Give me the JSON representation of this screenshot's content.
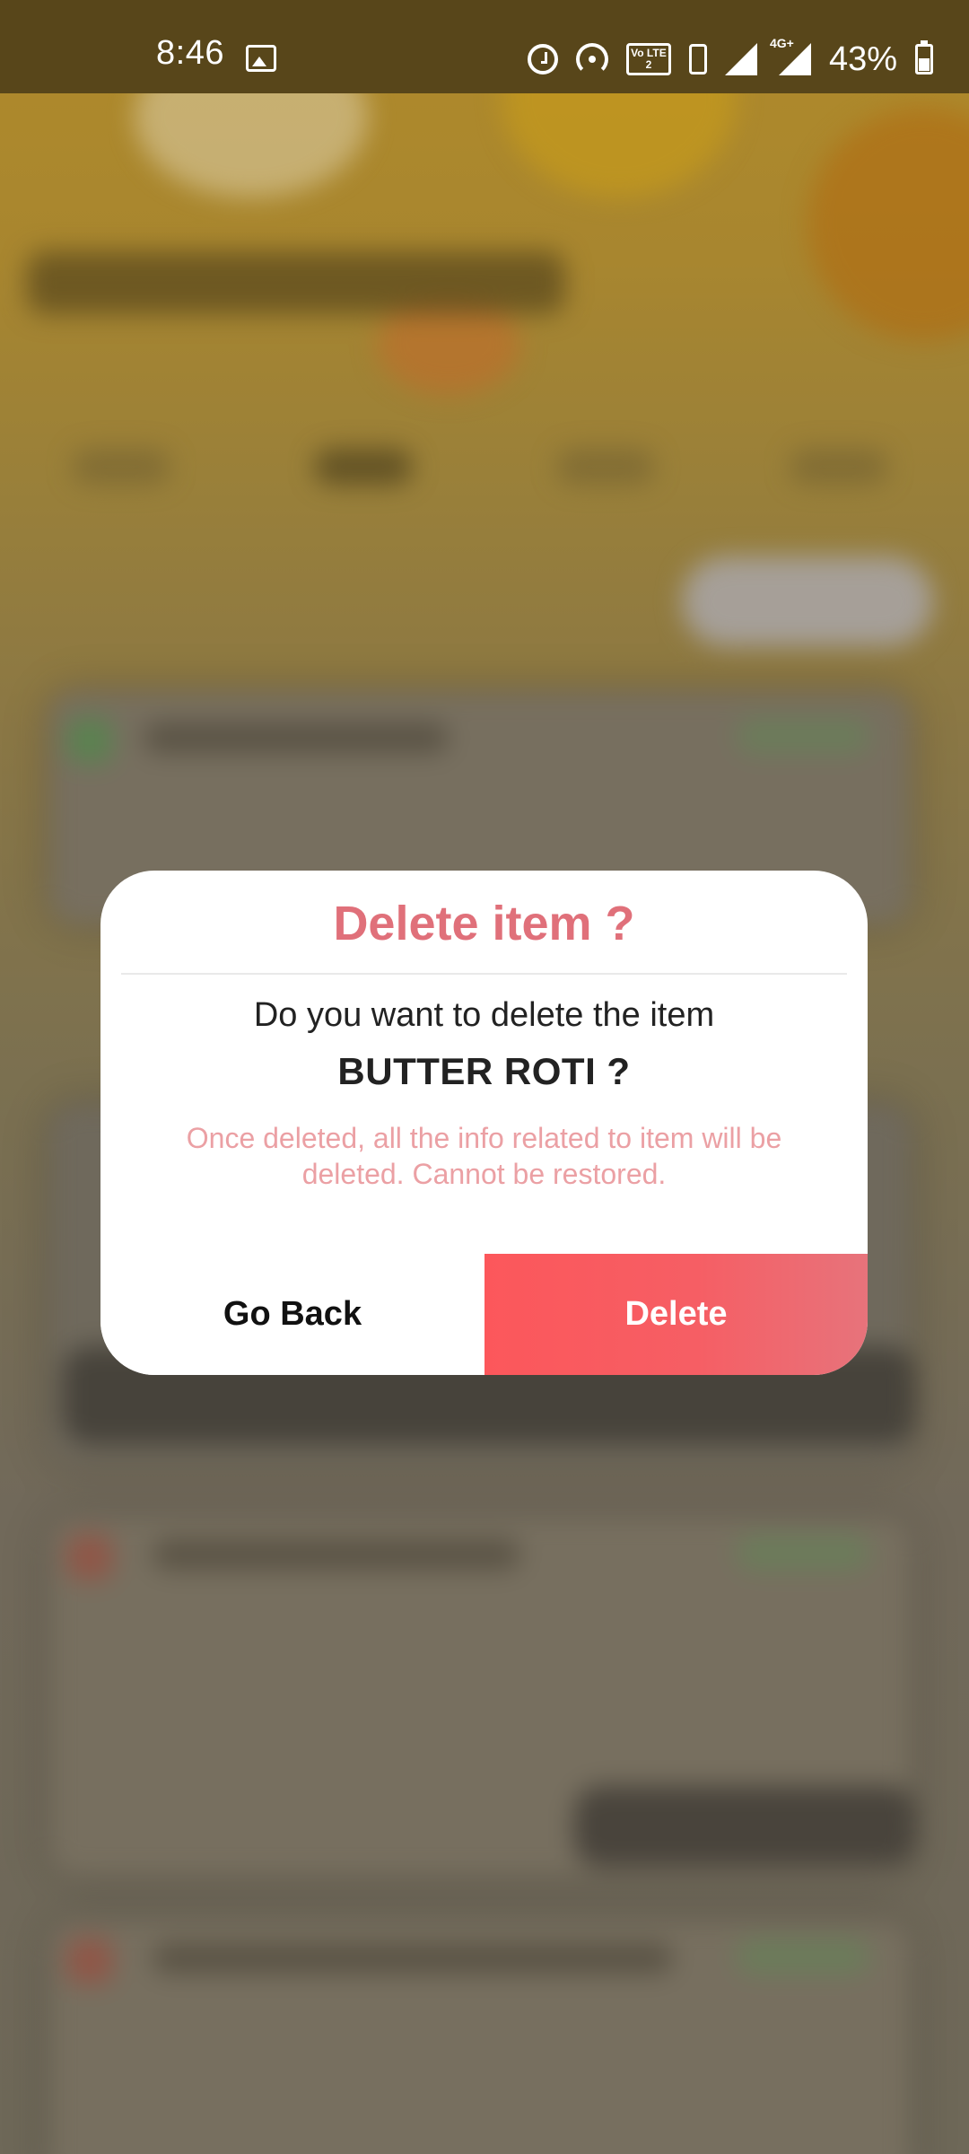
{
  "status_bar": {
    "time": "8:46",
    "battery_percent": "43%",
    "network_label": "4G+",
    "volte_label": "Vo LTE 2",
    "icons": [
      "gallery-icon",
      "alarm-icon",
      "hotspot-icon",
      "volte-icon",
      "vibrate-icon",
      "signal-icon",
      "signal-4g-icon",
      "battery-icon"
    ]
  },
  "dialog": {
    "title": "Delete item ?",
    "question": "Do you want to delete the item",
    "item_name": "BUTTER ROTI ?",
    "warning": "Once deleted, all the info related to item will be deleted. Cannot be restored.",
    "cancel_label": "Go Back",
    "confirm_label": "Delete"
  },
  "colors": {
    "title": "#e0707a",
    "warning": "#eba0a4",
    "delete_button": "#fc575b",
    "status_bar": "#58461a",
    "overlay": "#6f6657"
  }
}
